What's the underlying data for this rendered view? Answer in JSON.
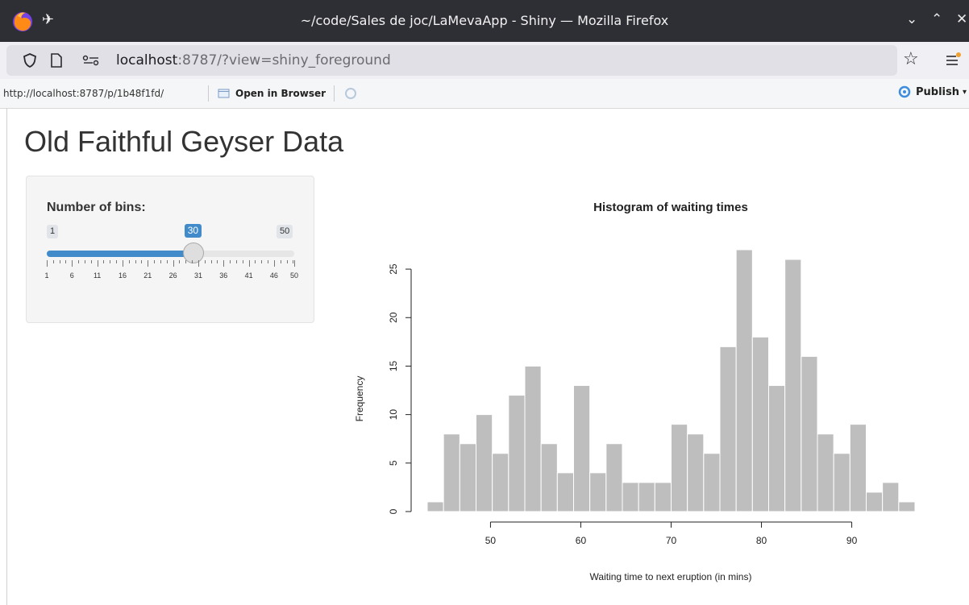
{
  "window": {
    "title": "~/code/Sales de joc/LaMevaApp - Shiny — Mozilla Firefox"
  },
  "navbar": {
    "url_host": "localhost",
    "url_rest": ":8787/?view=shiny_foreground"
  },
  "viewer_toolbar": {
    "url": "http://localhost:8787/p/1b48f1fd/",
    "open_in_browser_label": "Open in Browser",
    "publish_label": "Publish"
  },
  "app": {
    "title": "Old Faithful Geyser Data",
    "slider": {
      "label": "Number of bins:",
      "min": 1,
      "max": 50,
      "value": 30,
      "min_label": "1",
      "max_label": "50",
      "value_label": "30",
      "grid_labels": [
        "1",
        "6",
        "11",
        "16",
        "21",
        "26",
        "31",
        "36",
        "41",
        "46",
        "50"
      ]
    }
  },
  "chart_data": {
    "type": "bar",
    "title": "Histogram of waiting times",
    "xlabel": "Waiting time to next eruption (in mins)",
    "ylabel": "Frequency",
    "x_start": 43,
    "bin_width": 1.8,
    "values": [
      1,
      8,
      7,
      10,
      6,
      12,
      15,
      7,
      4,
      13,
      4,
      7,
      3,
      3,
      3,
      9,
      8,
      6,
      17,
      27,
      18,
      13,
      26,
      16,
      8,
      6,
      9,
      2,
      3,
      1
    ],
    "xlim": [
      43,
      97
    ],
    "ylim": [
      0,
      27
    ],
    "x_ticks": [
      "50",
      "60",
      "70",
      "80",
      "90"
    ],
    "y_ticks": [
      "0",
      "5",
      "10",
      "15",
      "20",
      "25"
    ],
    "bar_color": "#bebebe",
    "grid": false
  },
  "colors": {
    "titlebar": "#2e2e35",
    "accent": "#428bca"
  }
}
